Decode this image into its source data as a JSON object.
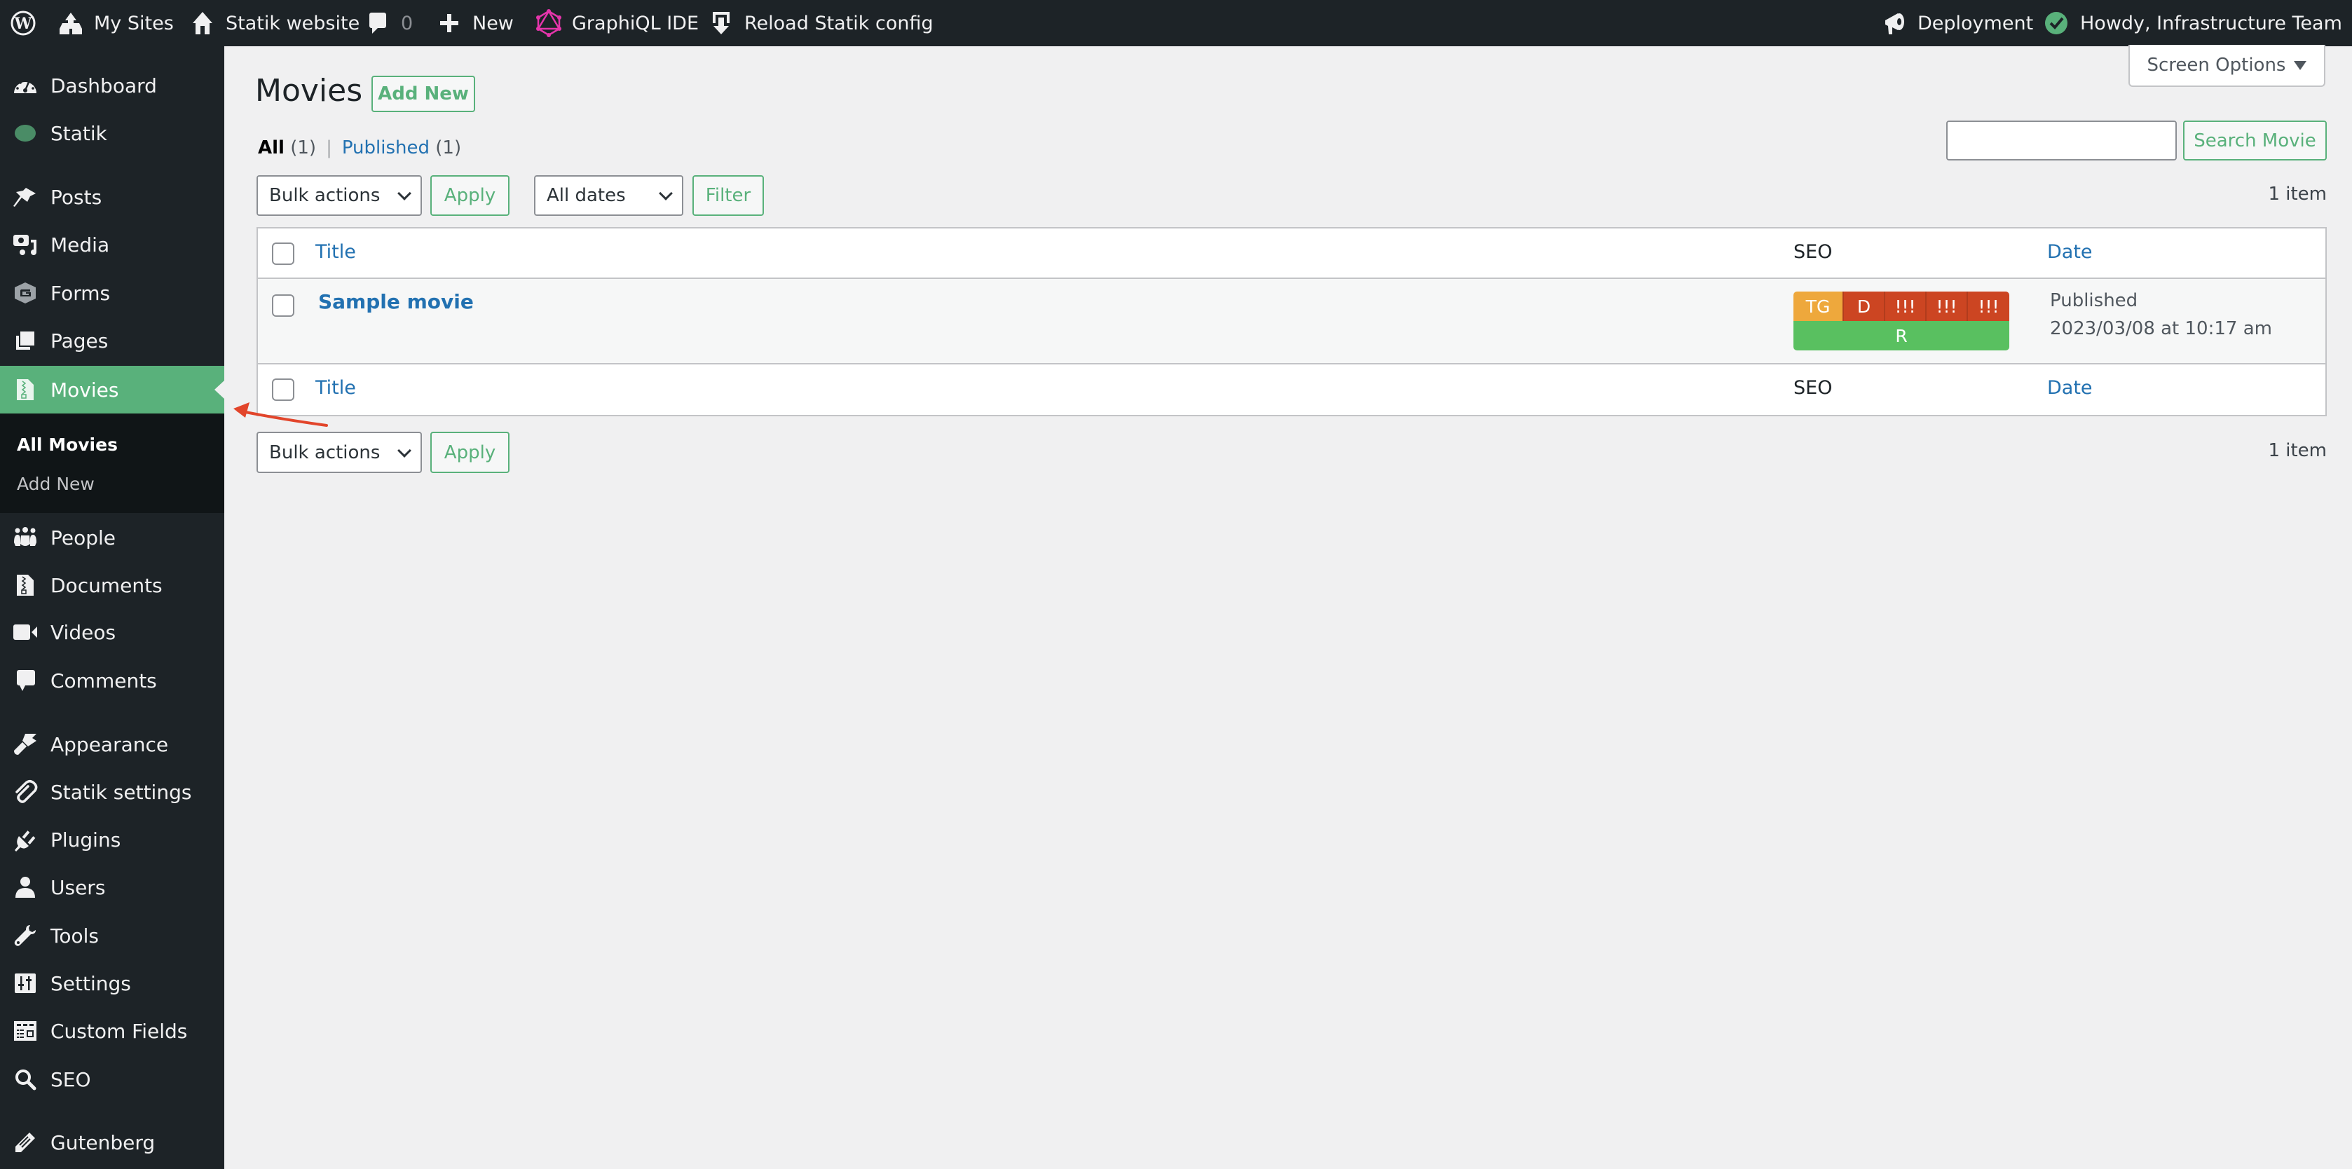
{
  "adminbar": {
    "items": [
      {
        "label": "",
        "icon": "wordpress-logo-icon"
      },
      {
        "label": "My Sites",
        "icon": "my-sites-icon"
      },
      {
        "label": "Statik website",
        "icon": "home-icon"
      },
      {
        "label": "0",
        "icon": "comment-bubble-icon"
      },
      {
        "label": "New",
        "icon": "plus-icon"
      },
      {
        "label": "GraphiQL IDE",
        "icon": "graphql-icon"
      },
      {
        "label": "Reload Statik config",
        "icon": "reload-download-icon"
      }
    ],
    "deployment_label": "Deployment",
    "deployment_status": "success",
    "howdy": "Howdy, Infrastructure Team",
    "colors": {
      "bar": "#1d2327",
      "graphql": "#e535ab",
      "deploy_ok": "#59b17b"
    }
  },
  "sidebar": {
    "items": [
      {
        "label": "Dashboard",
        "icon": "dashboard-gauge-icon"
      },
      {
        "label": "Statik",
        "icon": "statik-dot-icon"
      },
      {
        "label": "Posts",
        "icon": "pushpin-icon"
      },
      {
        "label": "Media",
        "icon": "media-icon"
      },
      {
        "label": "Forms",
        "icon": "forms-icon"
      },
      {
        "label": "Pages",
        "icon": "pages-icon"
      },
      {
        "label": "Movies",
        "icon": "archive-file-icon",
        "current": true
      },
      {
        "label": "People",
        "icon": "people-group-icon"
      },
      {
        "label": "Documents",
        "icon": "archive-file-icon"
      },
      {
        "label": "Videos",
        "icon": "video-camera-icon"
      },
      {
        "label": "Comments",
        "icon": "comment-bubble-icon"
      },
      {
        "label": "Appearance",
        "icon": "paintbrush-icon"
      },
      {
        "label": "Statik settings",
        "icon": "paperclip-icon"
      },
      {
        "label": "Plugins",
        "icon": "plug-icon"
      },
      {
        "label": "Users",
        "icon": "user-icon"
      },
      {
        "label": "Tools",
        "icon": "wrench-icon"
      },
      {
        "label": "Settings",
        "icon": "sliders-icon"
      },
      {
        "label": "Custom Fields",
        "icon": "custom-fields-icon"
      },
      {
        "label": "SEO",
        "icon": "search-icon"
      },
      {
        "label": "Gutenberg",
        "icon": "pencil-icon"
      }
    ],
    "submenu": [
      {
        "label": "All Movies",
        "current": true
      },
      {
        "label": "Add New"
      }
    ],
    "accent": "#59b17b"
  },
  "main": {
    "title": "Movies",
    "add_new": "Add New",
    "views": {
      "all": "All",
      "all_count": "(1)",
      "separator": "|",
      "published": "Published",
      "published_count": "(1)"
    },
    "screen_options": "Screen Options",
    "search": {
      "value": "",
      "placeholder": "",
      "button": "Search Movie"
    },
    "top_actions": {
      "bulk": "Bulk actions",
      "apply": "Apply",
      "dates": "All dates",
      "filter": "Filter",
      "count": "1 item"
    },
    "bottom_actions": {
      "bulk": "Bulk actions",
      "apply": "Apply",
      "count": "1 item"
    },
    "table": {
      "columns": [
        "Title",
        "SEO",
        "Date"
      ],
      "rows": [
        {
          "title": "Sample movie",
          "seo": {
            "top": [
              {
                "label": "TG",
                "color": "#eea83c"
              },
              {
                "label": "D",
                "color": "#cc4522"
              },
              {
                "label": "!!!",
                "color": "#cc4522"
              },
              {
                "label": "!!!",
                "color": "#cc4522"
              },
              {
                "label": "!!!",
                "color": "#cc4522"
              }
            ],
            "bottom": {
              "label": "R",
              "color": "#59c060"
            }
          },
          "status": "Published",
          "date": "2023/03/08 at 10:17 am"
        }
      ]
    }
  }
}
